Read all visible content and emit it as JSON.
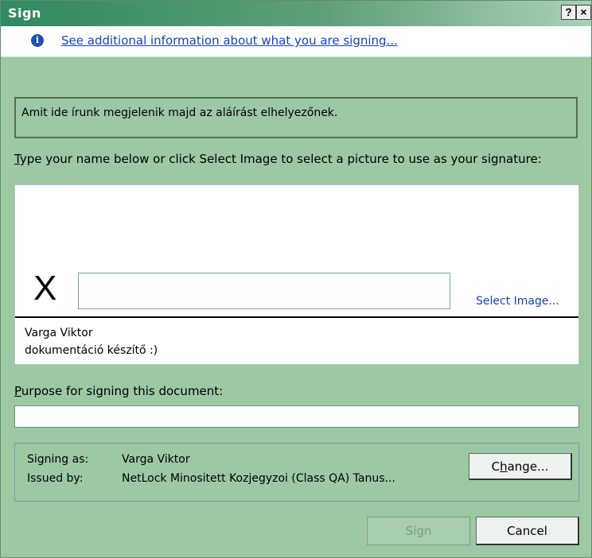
{
  "window": {
    "title": "Sign",
    "help_label": "?",
    "close_label": "×"
  },
  "info_bar": {
    "icon": "info-icon",
    "link_text": "See additional information about what you are signing..."
  },
  "message": {
    "text": "Amit ide írunk megjelenik majd az aláírást elhelyezőnek."
  },
  "instructions": {
    "first_letter": "T",
    "rest": "ype your name below or click Select Image to select a picture to use as your signature:"
  },
  "signature": {
    "x_mark": "X",
    "input_value": "",
    "select_image_label": "Select Image...",
    "signer_name": "Varga Viktor",
    "signer_title": "dokumentáció készítő :)"
  },
  "purpose": {
    "label_first": "P",
    "label_rest": "urpose for signing this document:",
    "value": ""
  },
  "signing_info": {
    "signing_as_label": "Signing as:",
    "signing_as_value": "Varga Viktor",
    "issued_by_label": "Issued by:",
    "issued_by_value": "NetLock Minositett Kozjegyzoi (Class QA) Tanus...",
    "change_label_pre": "C",
    "change_label_acc": "h",
    "change_label_post": "ange..."
  },
  "buttons": {
    "sign_label": "Sign",
    "cancel_label": "Cancel"
  },
  "colors": {
    "dialog_background": "#9cc8a4",
    "title_bar_start": "#2f8a5f",
    "link": "#1440c8"
  }
}
